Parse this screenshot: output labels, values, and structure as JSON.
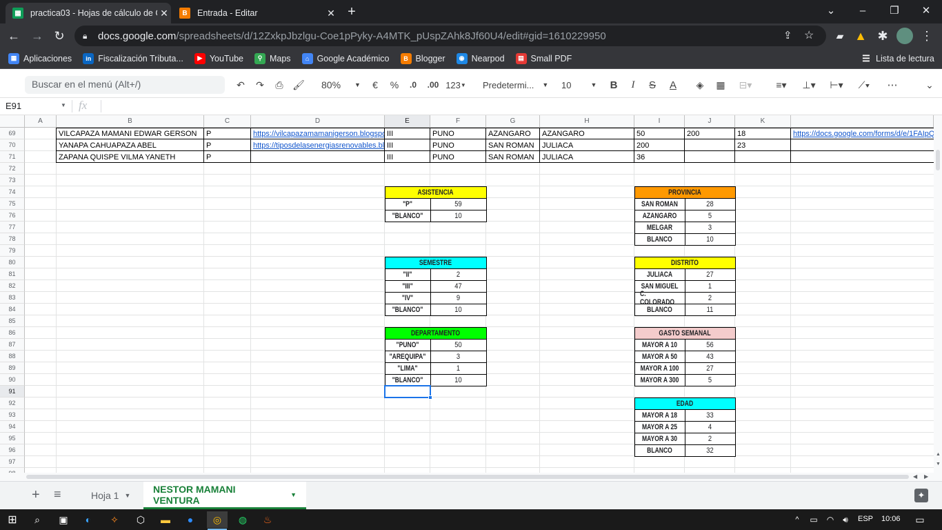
{
  "browser": {
    "tabs": [
      {
        "title": "practica03 - Hojas de cálculo de G",
        "icon": "sheets-icon",
        "color": "#0f9d58",
        "active": true
      },
      {
        "title": "Entrada - Editar",
        "icon": "blogger-icon",
        "color": "#f57c00",
        "active": false
      }
    ],
    "new_tab": "+",
    "window_controls": {
      "minimize": "–",
      "maximize": "❐",
      "close": "✕"
    },
    "url_host": "docs.google.com",
    "url_path": "/spreadsheets/d/12ZxkpJbzlgu-Coe1pPyky-A4MTK_pUspZAhk8Jf60U4/edit#gid=1610229950"
  },
  "bookmarks": {
    "items": [
      {
        "label": "Aplicaciones",
        "icon": "apps-grid-icon",
        "color": "#4285f4"
      },
      {
        "label": "Fiscalización Tributa...",
        "icon": "linkedin-icon",
        "color": "#0a66c2"
      },
      {
        "label": "YouTube",
        "icon": "youtube-icon",
        "color": "#ff0000"
      },
      {
        "label": "Maps",
        "icon": "maps-icon",
        "color": "#34a853"
      },
      {
        "label": "Google Académico",
        "icon": "scholar-icon",
        "color": "#4285f4"
      },
      {
        "label": "Blogger",
        "icon": "blogger-icon",
        "color": "#f57c00"
      },
      {
        "label": "Nearpod",
        "icon": "nearpod-icon",
        "color": "#1e88e5"
      },
      {
        "label": "Small PDF",
        "icon": "smallpdf-icon",
        "color": "#e53935"
      }
    ],
    "reading_list": "Lista de lectura"
  },
  "toolbar": {
    "menu_search_placeholder": "Buscar en el menú (Alt+/)",
    "zoom": "80%",
    "currency": "€",
    "percent": "%",
    "dec_less": ".0",
    "dec_more": ".00",
    "number_format": "123",
    "font": "Predetermi...",
    "font_size": "10",
    "bold": "B",
    "italic": "I",
    "strike": "S",
    "text_color": "A",
    "more": "⋯"
  },
  "formula_bar": {
    "name_box": "E91",
    "fx": "fx",
    "value": ""
  },
  "columns": [
    "A",
    "B",
    "C",
    "D",
    "E",
    "F",
    "G",
    "H",
    "I",
    "J",
    "K"
  ],
  "rows": [
    "69",
    "70",
    "71",
    "72",
    "73",
    "74",
    "75",
    "76",
    "77",
    "78",
    "79",
    "80",
    "81",
    "82",
    "83",
    "84",
    "85",
    "86",
    "87",
    "88",
    "89",
    "90",
    "91",
    "92",
    "93",
    "94",
    "95",
    "96",
    "97",
    "98"
  ],
  "selected_row": "91",
  "selected_col": "E",
  "data_rows": [
    {
      "b": "VILCAPAZA MAMANI EDWAR GERSON",
      "c": "P",
      "d": "https://vilcapazamamanigerson.blogspot",
      "e": "III",
      "f": "PUNO",
      "g": "AZANGARO",
      "h": "AZANGARO",
      "i": "50",
      "j": "200",
      "k": "18",
      "l": "https://docs.google.com/forms/d/e/1FAIpQL"
    },
    {
      "b": "YANAPA CAHUAPAZA ABEL",
      "c": "P",
      "d": "https://tiposdelasenergiasrenovables.blo",
      "e": "III",
      "f": "PUNO",
      "g": "SAN ROMAN",
      "h": "JULIACA",
      "i": "200",
      "j": "",
      "k": "23",
      "l": ""
    },
    {
      "b": "ZAPANA QUISPE VILMA YANETH",
      "c": "P",
      "d": "",
      "e": "III",
      "f": "PUNO",
      "g": "SAN ROMAN",
      "h": "JULIACA",
      "i": "36",
      "j": "",
      "k": "",
      "l": ""
    }
  ],
  "summaries_left": [
    {
      "title": "ASISTENCIA",
      "color": "#ffff00",
      "rows": [
        [
          "\"P\"",
          "59"
        ],
        [
          "\"BLANCO\"",
          "10"
        ]
      ]
    },
    {
      "title": "SEMESTRE",
      "color": "#00ffff",
      "rows": [
        [
          "\"II\"",
          "2"
        ],
        [
          "\"III\"",
          "47"
        ],
        [
          "\"IV\"",
          "9"
        ],
        [
          "\"BLANCO\"",
          "10"
        ]
      ]
    },
    {
      "title": "DEPARTAMENTO",
      "color": "#00ff00",
      "rows": [
        [
          "\"PUNO\"",
          "50"
        ],
        [
          "\"AREQUIPA\"",
          "3"
        ],
        [
          "\"LIMA\"",
          "1"
        ],
        [
          "\"BLANCO\"",
          "10"
        ]
      ]
    }
  ],
  "summaries_right": [
    {
      "title": "PROVINCIA",
      "color": "#ff9900",
      "rows": [
        [
          "SAN ROMAN",
          "28"
        ],
        [
          "AZANGARO",
          "5"
        ],
        [
          "MELGAR",
          "3"
        ],
        [
          "BLANCO",
          "10"
        ]
      ]
    },
    {
      "title": "DISTRITO",
      "color": "#ffff00",
      "rows": [
        [
          "JULIACA",
          "27"
        ],
        [
          "SAN MIGUEL",
          "1"
        ],
        [
          "C. COLORADO",
          "2"
        ],
        [
          "BLANCO",
          "11"
        ]
      ]
    },
    {
      "title": "GASTO SEMANAL",
      "color": "#f4cccc",
      "rows": [
        [
          "MAYOR A 10",
          "56"
        ],
        [
          "MAYOR A 50",
          "43"
        ],
        [
          "MAYOR A 100",
          "27"
        ],
        [
          "MAYOR A 300",
          "5"
        ]
      ]
    },
    {
      "title": "EDAD",
      "color": "#00ffff",
      "rows": [
        [
          "MAYOR A 18",
          "33"
        ],
        [
          "MAYOR A 25",
          "4"
        ],
        [
          "MAYOR A 30",
          "2"
        ],
        [
          "BLANCO",
          "32"
        ]
      ]
    }
  ],
  "sheets": {
    "add": "+",
    "list": "≡",
    "tabs": [
      {
        "label": "Hoja 1",
        "active": false
      },
      {
        "label": "NESTOR MAMANI VENTURA",
        "active": true
      }
    ]
  },
  "taskbar": {
    "language": "ESP",
    "time": "10:06"
  }
}
